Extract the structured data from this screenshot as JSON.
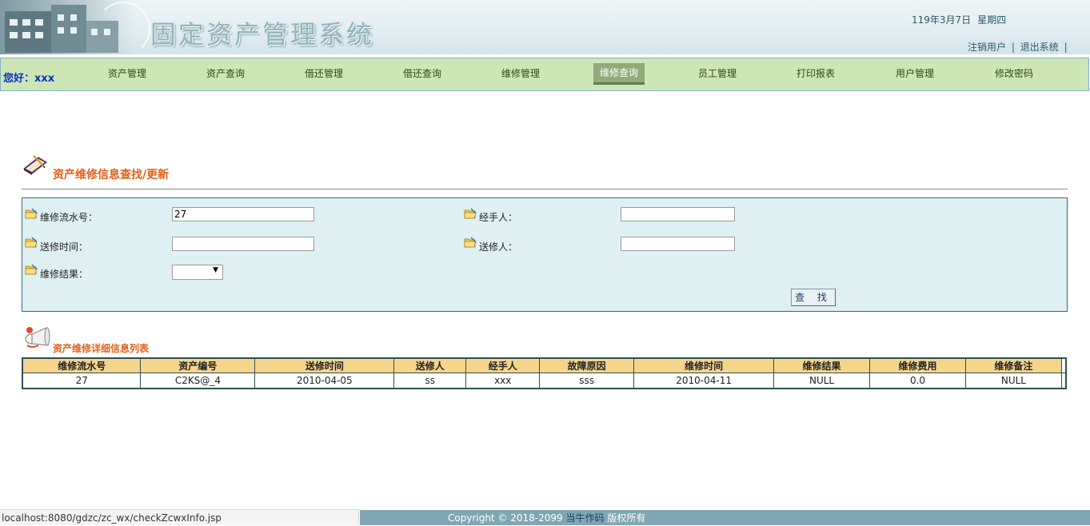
{
  "header": {
    "app_title": "固定资产管理系统",
    "date": "119年3月7日",
    "weekday": "星期四",
    "logout_user_link": "注销用户",
    "separator": "|",
    "exit_system_link": "退出系统",
    "trailing_separator": "|"
  },
  "nav": {
    "greeting": "您好：xxx",
    "items": [
      {
        "label": "资产管理"
      },
      {
        "label": "资产查询"
      },
      {
        "label": "借还管理"
      },
      {
        "label": "借还查询"
      },
      {
        "label": "维修管理"
      },
      {
        "label": "维修查询",
        "active": true
      },
      {
        "label": "员工管理"
      },
      {
        "label": "打印报表"
      },
      {
        "label": "用户管理"
      },
      {
        "label": "修改密码"
      }
    ]
  },
  "search": {
    "section_title": "资产维修信息查找/更新",
    "fields": {
      "repair_id_label": "维修流水号：",
      "repair_id_value": "27",
      "handler_label": "经手人：",
      "handler_value": "",
      "send_time_label": "送修时间：",
      "send_time_value": "",
      "sender_label": "送修人：",
      "sender_value": "",
      "result_label": "维修结果：",
      "result_value": ""
    },
    "search_button": "查 找"
  },
  "results": {
    "section_title": "资产维修详细信息列表",
    "columns": [
      "维修流水号",
      "资产编号",
      "送修时间",
      "送修人",
      "经手人",
      "故障原因",
      "维修时间",
      "维修结果",
      "维修费用",
      "维修备注"
    ],
    "rows": [
      [
        "27",
        "C2KS@_4",
        "2010-04-05",
        "ss",
        "xxx",
        "sss",
        "2010-04-11",
        "NULL",
        "0.0",
        "NULL"
      ]
    ]
  },
  "footer": {
    "status_url": "localhost:8080/gdzc/zc_wx/checkZcwxInfo.jsp",
    "copyright_prefix": "Copyright © 2018-2099",
    "copyright_link": "当牛作码",
    "copyright_suffix": "版权所有"
  },
  "colors": {
    "nav_bg": "#cde6b6",
    "nav_active": "#8fab7a",
    "section_title": "#e0601a",
    "search_panel_bg": "#dff0f3",
    "table_header_bg": "#f6d48c",
    "footer_bg": "#7fa6b4",
    "greeting": "#0032c8"
  },
  "icons": {
    "section_icon": "book-pen-icon",
    "field_icon": "folder-pen-icon",
    "results_icon": "speaker-icon"
  }
}
